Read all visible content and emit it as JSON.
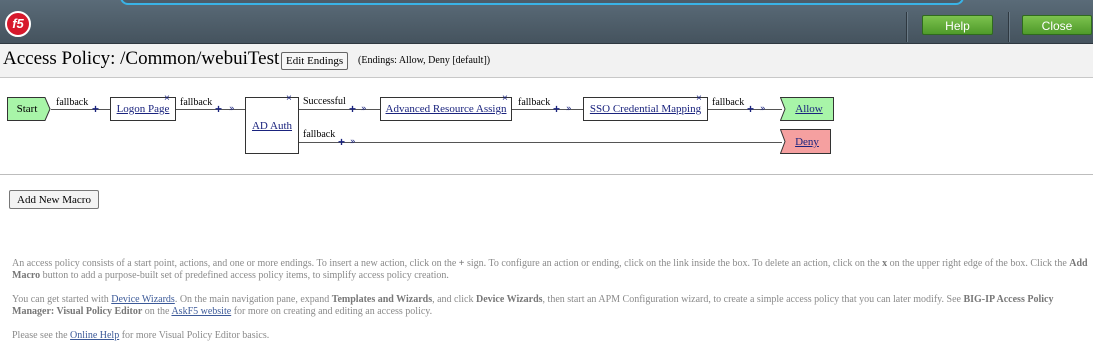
{
  "header": {
    "logo_text": "f5",
    "help_label": "Help",
    "close_label": "Close",
    "accent_color": "#5aa832"
  },
  "title_bar": {
    "title": "Access Policy: /Common/webuiTest",
    "edit_endings_label": "Edit Endings",
    "endings_info": "(Endings: Allow, Deny [default])"
  },
  "policy": {
    "start_label": "Start",
    "nodes": [
      {
        "label": "Logon Page"
      },
      {
        "label": "AD Auth"
      },
      {
        "label": "Advanced Resource Assign"
      },
      {
        "label": "SSO Credential Mapping"
      }
    ],
    "branches": {
      "start_to_logon": "fallback",
      "logon_to_ad": "fallback",
      "ad_success": "Successful",
      "ad_fallback": "fallback",
      "ara_to_sso": "fallback",
      "sso_to_allow": "fallback"
    },
    "endings": [
      {
        "label": "Allow",
        "color": "#a8f5a8"
      },
      {
        "label": "Deny",
        "color": "#f5a0a0"
      }
    ],
    "delete_glyph": "×",
    "insert_glyph": "+"
  },
  "macro_button_label": "Add New Macro",
  "help": {
    "p1": {
      "a": "An access policy consists of a start point, actions, and one or more endings. To insert a new action, click on the ",
      "b1": "+",
      "c": " sign. To configure an action or ending, click on the link inside the box. To delete an action, click on the ",
      "b2": "x",
      "d": " on the upper right edge of the box. Click the ",
      "b3": "Add Macro",
      "e": " button to add a purpose-built set of predefined access policy items, to simplify access policy creation."
    },
    "p2": {
      "a": "You can get started with ",
      "link1": "Device Wizards",
      "b": ". On the main navigation pane, expand ",
      "bold1": "Templates and Wizards",
      "c": ", and click ",
      "bold2": "Device Wizards",
      "d": ", then start an APM Configuration wizard, to create a simple access policy that you can later modify. See ",
      "bold3": "BIG-IP Access Policy Manager: Visual Policy Editor",
      "e": " on the ",
      "link2": "AskF5 website",
      "f": " for more on creating and editing an access policy."
    },
    "p3": {
      "a": "Please see the ",
      "link": "Online Help",
      "b": " for more Visual Policy Editor basics."
    }
  }
}
